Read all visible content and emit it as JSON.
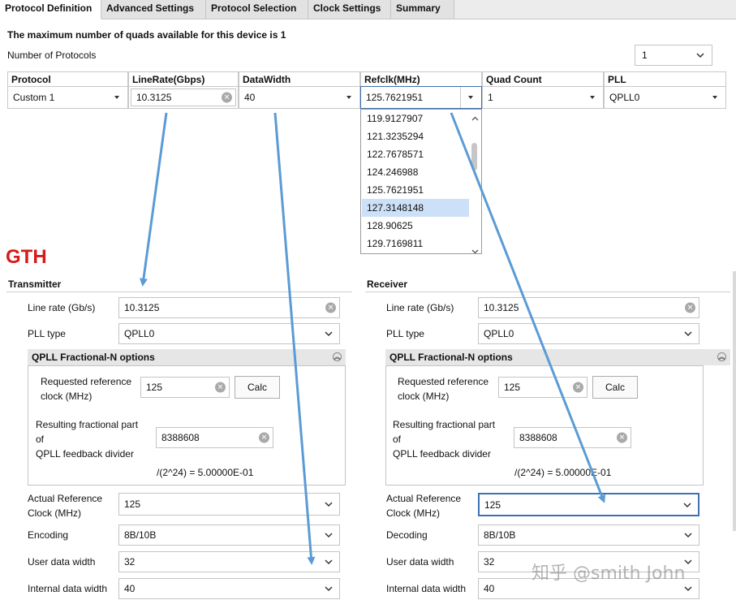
{
  "tabs": [
    {
      "label": "Protocol Definition",
      "active": true
    },
    {
      "label": "Advanced Settings",
      "active": false
    },
    {
      "label": "Protocol Selection",
      "active": false
    },
    {
      "label": "Clock Settings",
      "active": false
    },
    {
      "label": "Summary",
      "active": false
    }
  ],
  "info_text": "The maximum number of quads available for this device is 1",
  "num_protocols": {
    "label": "Number of Protocols",
    "value": "1"
  },
  "protocol_table": {
    "headers": [
      "Protocol",
      "LineRate(Gbps)",
      "DataWidth",
      "Refclk(MHz)",
      "Quad Count",
      "PLL"
    ],
    "row": {
      "protocol": "Custom 1",
      "line_rate": "10.3125",
      "data_width": "40",
      "refclk": "125.7621951",
      "quad_count": "1",
      "pll": "QPLL0"
    }
  },
  "refclk_dropdown": {
    "options": [
      "119.9127907",
      "121.3235294",
      "122.7678571",
      "124.246988",
      "125.7621951",
      "127.3148148",
      "128.90625",
      "129.7169811"
    ],
    "highlighted": "127.3148148"
  },
  "annotation_label": "GTH",
  "transmitter": {
    "title": "Transmitter",
    "line_rate_label": "Line rate (Gb/s)",
    "line_rate": "10.3125",
    "pll_type_label": "PLL type",
    "pll_type": "QPLL0",
    "fracn_title": "QPLL Fractional-N options",
    "req_ref_label_1": "Requested reference",
    "req_ref_label_2": "clock (MHz)",
    "req_ref": "125",
    "calc_label": "Calc",
    "frac_label_1": "Resulting fractional part",
    "frac_label_2": "of",
    "frac_label_3": "QPLL feedback divider",
    "frac_value": "8388608",
    "frac_formula": "/(2^24) = 5.00000E-01",
    "actual_ref_label_1": "Actual Reference",
    "actual_ref_label_2": "Clock (MHz)",
    "actual_ref": "125",
    "encoding_label": "Encoding",
    "encoding": "8B/10B",
    "user_width_label": "User data width",
    "user_width": "32",
    "internal_width_label": "Internal data width",
    "internal_width": "40"
  },
  "receiver": {
    "title": "Receiver",
    "line_rate_label": "Line rate (Gb/s)",
    "line_rate": "10.3125",
    "pll_type_label": "PLL type",
    "pll_type": "QPLL0",
    "fracn_title": "QPLL Fractional-N options",
    "req_ref_label_1": "Requested reference",
    "req_ref_label_2": "clock (MHz)",
    "req_ref": "125",
    "calc_label": "Calc",
    "frac_label_1": "Resulting fractional part",
    "frac_label_2": "of",
    "frac_label_3": "QPLL feedback divider",
    "frac_value": "8388608",
    "frac_formula": "/(2^24) = 5.00000E-01",
    "actual_ref_label_1": "Actual Reference",
    "actual_ref_label_2": "Clock (MHz)",
    "actual_ref": "125",
    "decoding_label": "Decoding",
    "decoding": "8B/10B",
    "user_width_label": "User data width",
    "user_width": "32",
    "internal_width_label": "Internal data width",
    "internal_width": "40"
  },
  "watermark": "知乎 @smith John",
  "colors": {
    "arrow": "#5b9bd5",
    "gth": "#d71a1a",
    "focus": "#3f6fb5",
    "highlight": "#cce0f7"
  }
}
